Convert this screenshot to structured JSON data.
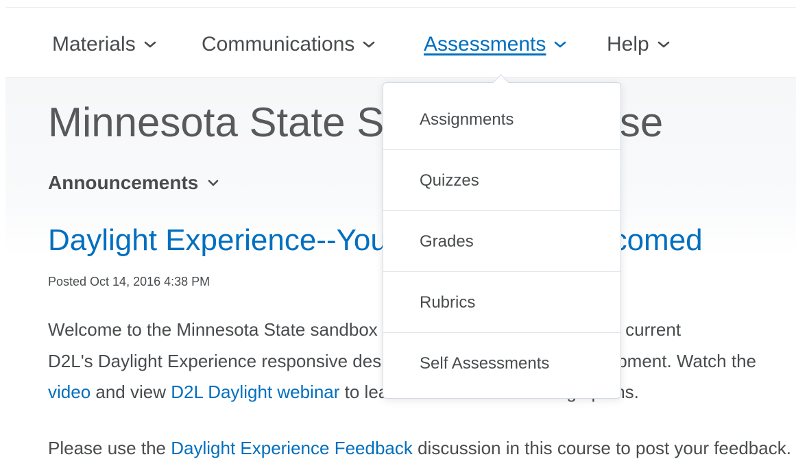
{
  "nav": {
    "items": [
      {
        "label": "Materials"
      },
      {
        "label": "Communications"
      },
      {
        "label": "Assessments"
      },
      {
        "label": "Help"
      }
    ]
  },
  "dropdown": {
    "items": [
      {
        "label": "Assignments"
      },
      {
        "label": "Quizzes"
      },
      {
        "label": "Grades"
      },
      {
        "label": "Rubrics"
      },
      {
        "label": "Self Assessments"
      }
    ]
  },
  "page": {
    "course_title": "Minnesota State Sandbox Course",
    "widget_heading": "Announcements",
    "announcement": {
      "title": "Daylight Experience--Your feedback is welcomed",
      "posted": "Posted Oct 14, 2016 4:38 PM",
      "line1": "Welcome to the Minnesota State sandbox course where you can see the current",
      "line2": "D2L's Daylight Experience responsive design that is under active development. Watch the",
      "line3_link1": "video",
      "line3_mid": " and view ",
      "line3_link2": "D2L Daylight webinar",
      "line3_end": " to learn more about the design plans.",
      "line4_start": "Please use the ",
      "line4_link": "Daylight Experience Feedback",
      "line4_end": " discussion in this course to post your feedback."
    }
  },
  "colors": {
    "link": "#006fbf",
    "text": "#494c4e"
  }
}
